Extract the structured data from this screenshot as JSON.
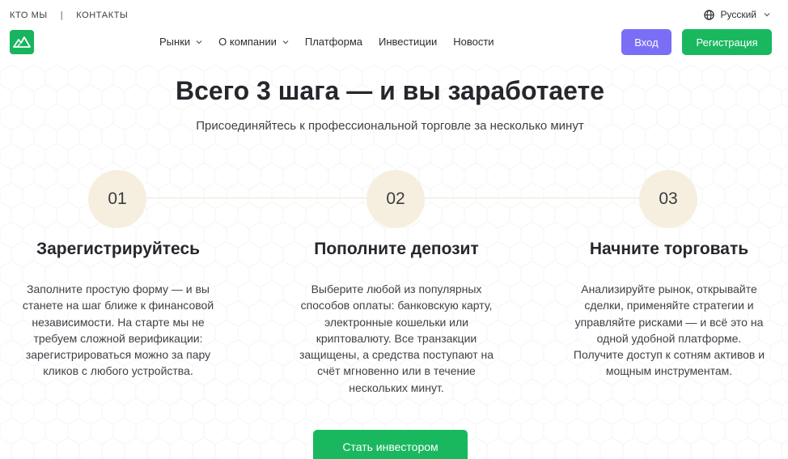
{
  "topbar": {
    "links": [
      "КТО МЫ",
      "КОНТАКТЫ"
    ],
    "separator": "|",
    "language": "Русский"
  },
  "nav": {
    "items": [
      {
        "label": "Рынки",
        "dropdown": true
      },
      {
        "label": "О компании",
        "dropdown": true
      },
      {
        "label": "Платформа",
        "dropdown": false
      },
      {
        "label": "Инвестиции",
        "dropdown": false
      },
      {
        "label": "Новости",
        "dropdown": false
      }
    ],
    "login_label": "Вход",
    "register_label": "Регистрация"
  },
  "hero": {
    "title": "Всего 3 шага — и вы заработаете",
    "subtitle": "Присоединяйтесь к профессиональной торговле за несколько минут"
  },
  "steps": [
    {
      "number": "01",
      "title": "Зарегистрируйтесь",
      "lines": [
        "Заполните простую форму — и вы",
        "станете на шаг ближе к финансовой",
        "независимости. На старте мы не",
        "требуем сложной верификации:",
        "зарегистрироваться можно за пару",
        "кликов с любого устройства."
      ]
    },
    {
      "number": "02",
      "title": "Пополните депозит",
      "lines": [
        "Выберите любой из популярных",
        "способов оплаты: банковскую карту,",
        "электронные кошельки или",
        "криптовалюту. Все транзакции",
        "защищены, а средства поступают на",
        "счёт мгновенно или в течение",
        "нескольких минут."
      ]
    },
    {
      "number": "03",
      "title": "Начните торговать",
      "lines": [
        "Анализируйте рынок, открывайте",
        "сделки, применяйте стратегии и",
        "управляйте рисками — и всё это на",
        "одной удобной платформе.",
        "Получите доступ к сотням активов и",
        "мощным инструментам."
      ]
    }
  ],
  "cta_label": "Стать инвестором",
  "colors": {
    "brand_green": "#19b85f",
    "login_purple": "#7b6ef6",
    "step_circle": "#f6efdf"
  }
}
